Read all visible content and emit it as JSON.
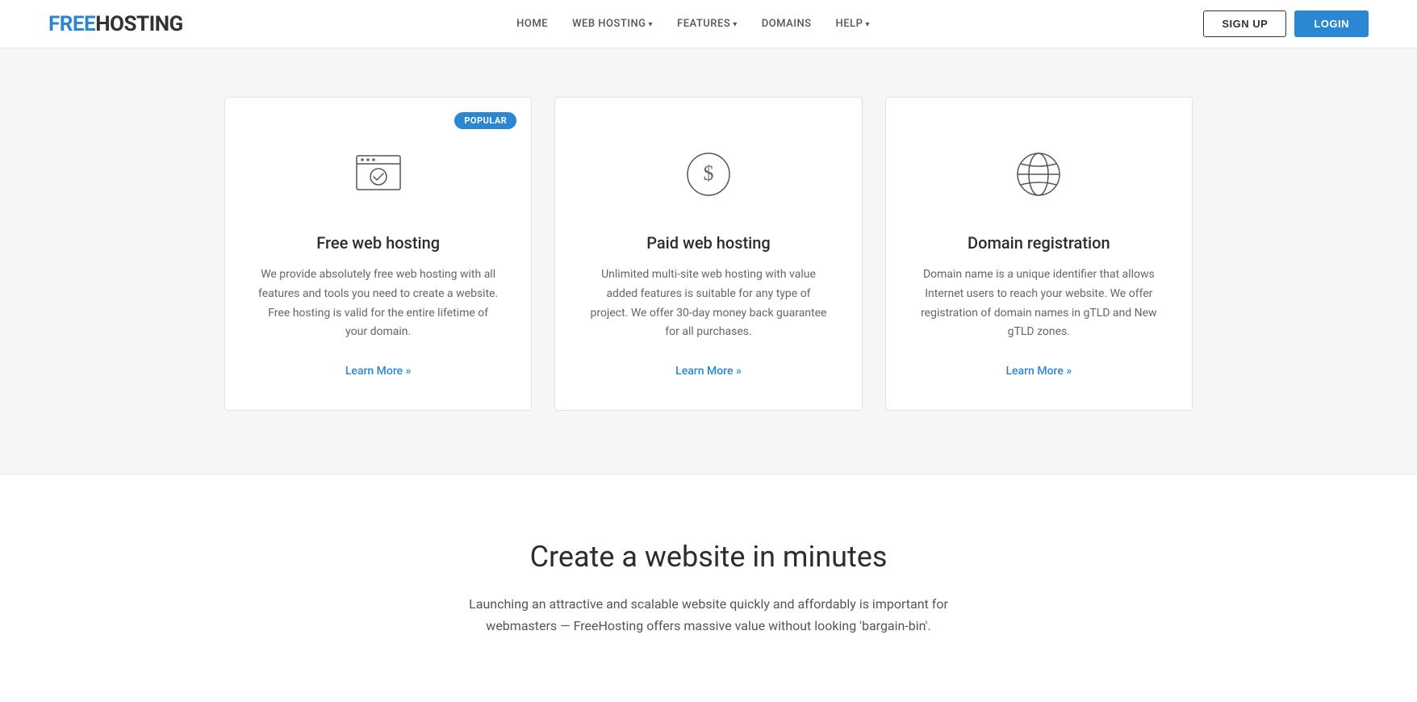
{
  "header": {
    "logo_free": "FREE",
    "logo_hosting": "HOSTING",
    "nav": [
      {
        "label": "HOME",
        "dropdown": false
      },
      {
        "label": "WEB HOSTING",
        "dropdown": true
      },
      {
        "label": "FEATURES",
        "dropdown": true
      },
      {
        "label": "DOMAINS",
        "dropdown": false
      },
      {
        "label": "HELP",
        "dropdown": true
      }
    ],
    "signup_label": "SIGN UP",
    "login_label": "LOGIN"
  },
  "cards": [
    {
      "id": "free-web-hosting",
      "popular": true,
      "popular_label": "POPULAR",
      "title": "Free web hosting",
      "desc": "We provide absolutely free web hosting with all features and tools you need to create a website. Free hosting is valid for the entire lifetime of your domain.",
      "link": "Learn More »"
    },
    {
      "id": "paid-web-hosting",
      "popular": false,
      "title": "Paid web hosting",
      "desc": "Unlimited multi-site web hosting with value added features is suitable for any type of project. We offer 30-day money back guarantee for all purchases.",
      "link": "Learn More »"
    },
    {
      "id": "domain-registration",
      "popular": false,
      "title": "Domain registration",
      "desc": "Domain name is a unique identifier that allows Internet users to reach your website. We offer registration of domain names in gTLD and New gTLD zones.",
      "link": "Learn More »"
    }
  ],
  "bottom": {
    "title": "Create a website in minutes",
    "desc": "Launching an attractive and scalable website quickly and affordably is important for webmasters — FreeHosting offers massive value without looking 'bargain-bin'."
  }
}
